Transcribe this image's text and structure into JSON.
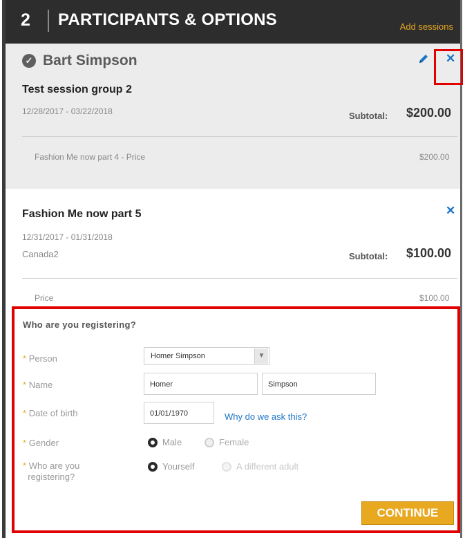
{
  "header": {
    "step_number": "2",
    "title": "PARTICIPANTS & OPTIONS",
    "add_sessions_label": "Add sessions"
  },
  "participant": {
    "name": "Bart Simpson",
    "icons": {
      "status": "check-circle-icon",
      "edit": "pencil-icon",
      "remove": "close-icon"
    }
  },
  "session_group": {
    "title": "Test session group 2",
    "dates": "12/28/2017 - 03/22/2018",
    "subtotal_label": "Subtotal:",
    "subtotal_value": "$200.00",
    "line_items": [
      {
        "label": "Fashion Me now part 4 - Price",
        "price": "$200.00"
      }
    ]
  },
  "session": {
    "title": "Fashion Me now part 5",
    "dates": "12/31/2017 - 01/31/2018",
    "location": "Canada2",
    "subtotal_label": "Subtotal:",
    "subtotal_value": "$100.00",
    "line_items": [
      {
        "label": "Price",
        "price": "$100.00"
      }
    ]
  },
  "registration": {
    "heading": "Who are you registering?",
    "required_mark": "*",
    "person": {
      "label": "Person",
      "selected": "Homer Simpson"
    },
    "name": {
      "label": "Name",
      "first": "Homer",
      "last": "Simpson"
    },
    "dob": {
      "label": "Date of birth",
      "value": "01/01/1970",
      "help_link": "Why do we ask this?"
    },
    "gender": {
      "label": "Gender",
      "options": [
        "Male",
        "Female"
      ],
      "selected": "Male"
    },
    "who": {
      "label_line1": "Who are you",
      "label_line2": "registering?",
      "options": [
        "Yourself",
        "A different adult"
      ],
      "selected": "Yourself"
    },
    "continue_label": "CONTINUE"
  },
  "colors": {
    "header_bg": "#2d2d2d",
    "accent": "#e8a820",
    "link": "#1b74c8",
    "highlight_border": "#e00000"
  }
}
